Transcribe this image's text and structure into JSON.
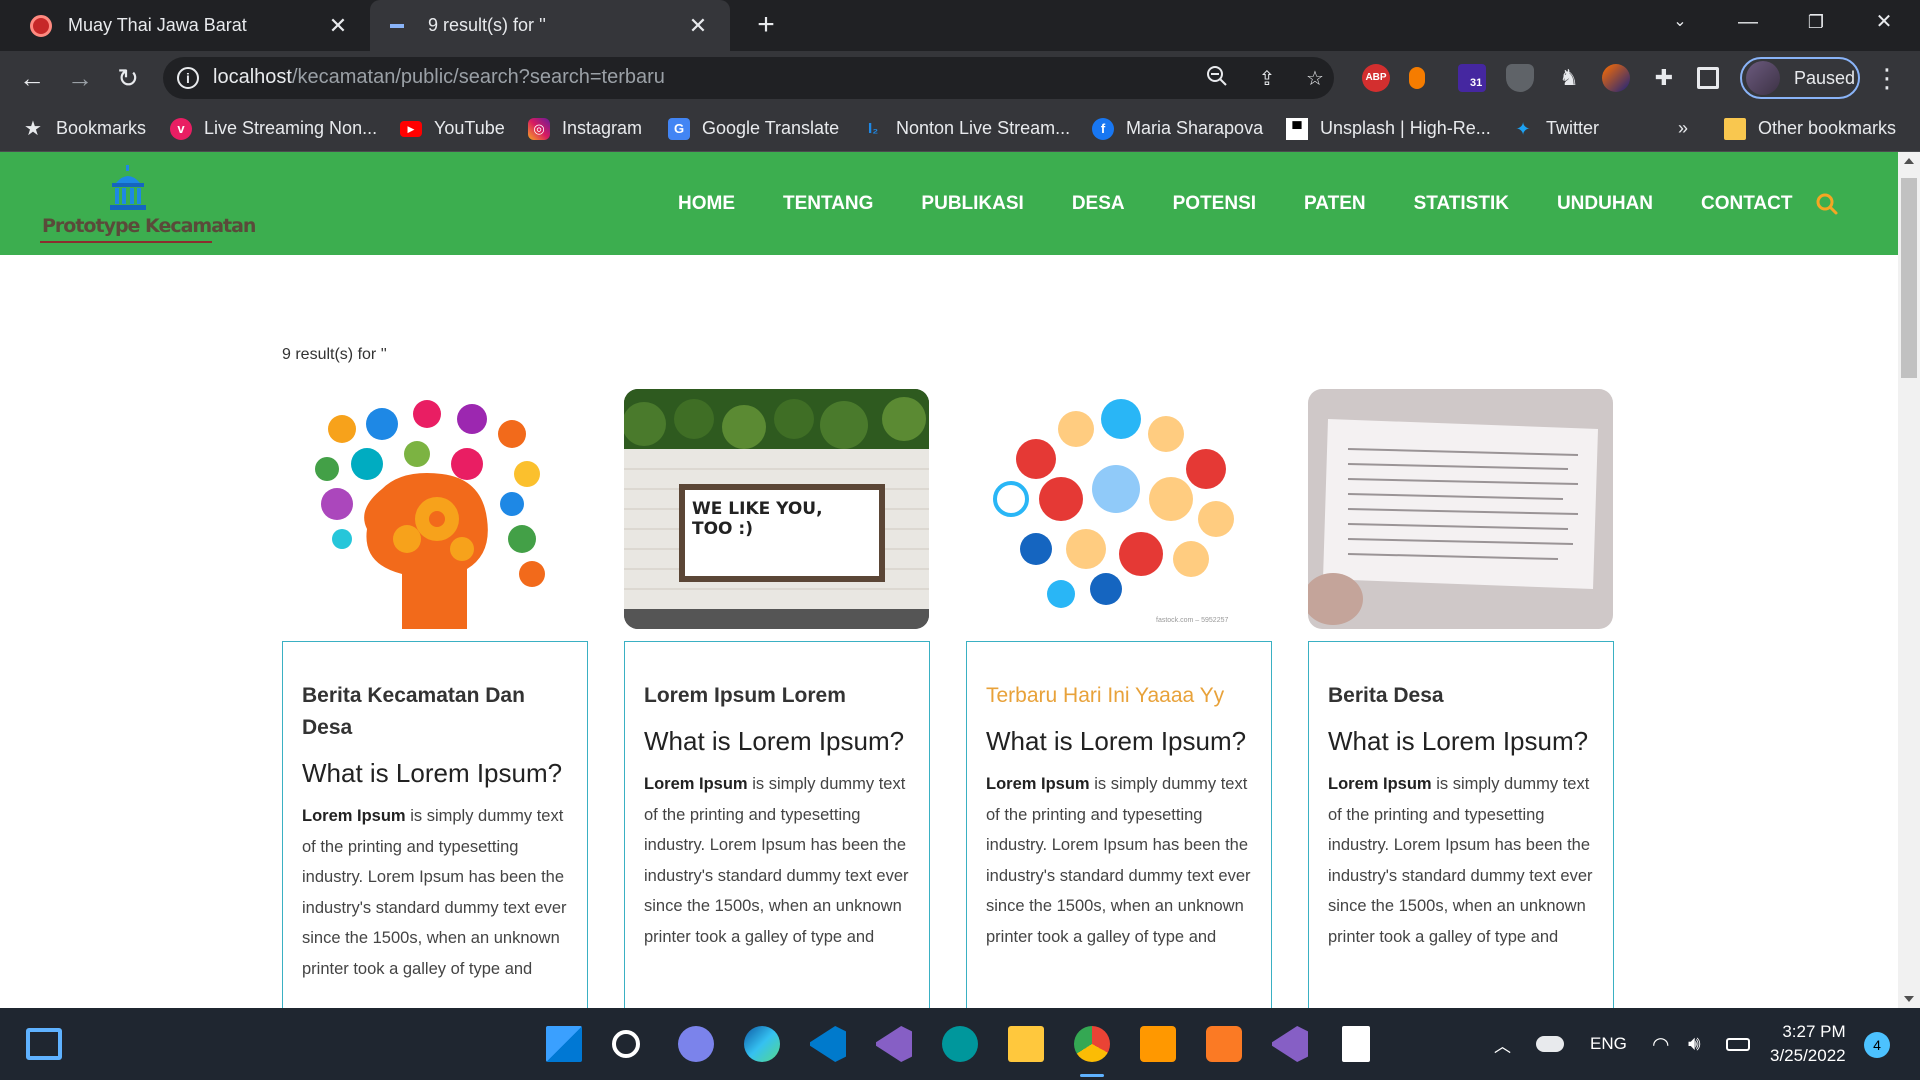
{
  "browser": {
    "tabs": [
      {
        "title": "Muay Thai Jawa Barat",
        "active": false
      },
      {
        "title": "9 result(s) for ''",
        "active": true
      }
    ],
    "url_host": "localhost",
    "url_path": "/kecamatan/public/search?search=terbaru",
    "profile_status": "Paused",
    "extension_badge": "31",
    "abp_label": "ABP"
  },
  "bookmarks": {
    "items": [
      {
        "label": "Bookmarks",
        "icon": "star-icon"
      },
      {
        "label": "Live Streaming Non...",
        "icon": "vidio-icon"
      },
      {
        "label": "YouTube",
        "icon": "youtube-icon"
      },
      {
        "label": "Instagram",
        "icon": "instagram-icon"
      },
      {
        "label": "Google Translate",
        "icon": "translate-icon"
      },
      {
        "label": "Nonton Live Stream...",
        "icon": "stream-icon"
      },
      {
        "label": "Maria Sharapova",
        "icon": "facebook-icon"
      },
      {
        "label": "Unsplash | High-Re...",
        "icon": "unsplash-icon"
      },
      {
        "label": "Twitter",
        "icon": "twitter-icon"
      }
    ],
    "overflow": "»",
    "other": "Other bookmarks"
  },
  "site": {
    "logo_text": "Prototype Kecamatan",
    "nav": [
      "HOME",
      "TENTANG",
      "PUBLIKASI",
      "DESA",
      "POTENSI",
      "PATEN",
      "STATISTIK",
      "UNDUHAN",
      "CONTACT"
    ],
    "results_text": "9 result(s) for ''",
    "cards": [
      {
        "title": "Berita Kecamatan Dan Desa",
        "highlight": false,
        "heading": "What is Lorem Ipsum?",
        "bold": "Lorem Ipsum",
        "body": " is simply dummy text of the printing and typesetting industry. Lorem Ipsum has been the industry's standard dummy text ever since the 1500s, when an unknown printer took a galley of type and"
      },
      {
        "title": "Lorem Ipsum Lorem",
        "highlight": false,
        "heading": "What is Lorem Ipsum?",
        "bold": "Lorem Ipsum",
        "body": " is simply dummy text of the printing and typesetting industry. Lorem Ipsum has been the industry's standard dummy text ever since the 1500s, when an unknown printer took a galley of type and"
      },
      {
        "title": "Terbaru Hari Ini Yaaaa Yy",
        "highlight": true,
        "heading": "What is Lorem Ipsum?",
        "bold": "Lorem Ipsum",
        "body": " is simply dummy text of the printing and typesetting industry. Lorem Ipsum has been the industry's standard dummy text ever since the 1500s, when an unknown printer took a galley of type and"
      },
      {
        "title": "Berita Desa",
        "highlight": false,
        "heading": "What is Lorem Ipsum?",
        "bold": "Lorem Ipsum",
        "body": " is simply dummy text of the printing and typesetting industry. Lorem Ipsum has been the industry's standard dummy text ever since the 1500s, when an unknown printer took a galley of type and"
      }
    ],
    "billboard_text": "WE LIKE YOU, TOO :)",
    "image_credit": "fastock.com – 5952257",
    "colors": {
      "header_green": "#3cae4f",
      "accent_orange": "#e8a23a",
      "card_border": "#3ab0c3"
    }
  },
  "taskbar": {
    "lang": "ENG",
    "time": "3:27 PM",
    "date": "3/25/2022",
    "notifications": "4"
  }
}
